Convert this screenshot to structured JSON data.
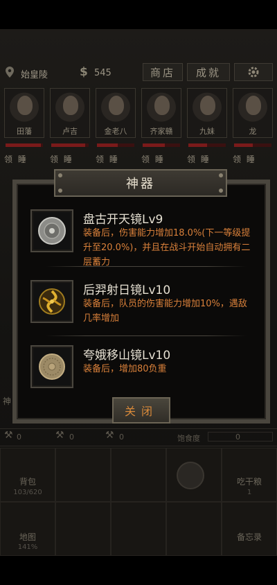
{
  "header": {
    "location": "始皇陵",
    "money_symbol": "$",
    "money": "545",
    "shop_label": "商店",
    "achievements_label": "成就"
  },
  "members": [
    {
      "name": "田藩",
      "action": "领 睡",
      "hp": 0.95
    },
    {
      "name": "卢吉",
      "action": "领 睡",
      "hp": 0.9
    },
    {
      "name": "金老八",
      "action": "领 睡",
      "hp": 0.55
    },
    {
      "name": "齐家赣",
      "action": "领 睡",
      "hp": 0.6
    },
    {
      "name": "九妹",
      "action": "领 睡",
      "hp": 0.5
    },
    {
      "name": "龙",
      "action": "领 睡",
      "hp": 0.5
    }
  ],
  "modal": {
    "title": "神器",
    "items": [
      {
        "title": "盘古开天镜Lv9",
        "desc": "装备后，伤害能力增加18.0%(下一等级提升至20.0%)，并且在战斗开始自动拥有二层蓄力",
        "icon": "silver-mirror-icon"
      },
      {
        "title": "后羿射日镜Lv10",
        "desc": "装备后，队员的伤害能力增加10%，遇敌几率增加",
        "icon": "sun-mirror-icon"
      },
      {
        "title": "夸娥移山镜Lv10",
        "desc": "装备后，增加80负重",
        "icon": "bronze-mirror-icon"
      }
    ],
    "close_label": "关闭"
  },
  "hud": {
    "stat1": "0",
    "stat2": "0",
    "stat3": "0",
    "hunger_label": "饱食度",
    "hunger_value": "0",
    "side_label": "神",
    "bag_label": "背包",
    "bag_count": "103/620",
    "eat_label": "吃干粮",
    "eat_count": "1",
    "map_label": "地图",
    "map_pct": "141%",
    "memo_label": "备忘录"
  },
  "colors": {
    "accent_orange": "#d9803a",
    "hp_red": "#7a1a1a",
    "frame": "#4a463e"
  }
}
